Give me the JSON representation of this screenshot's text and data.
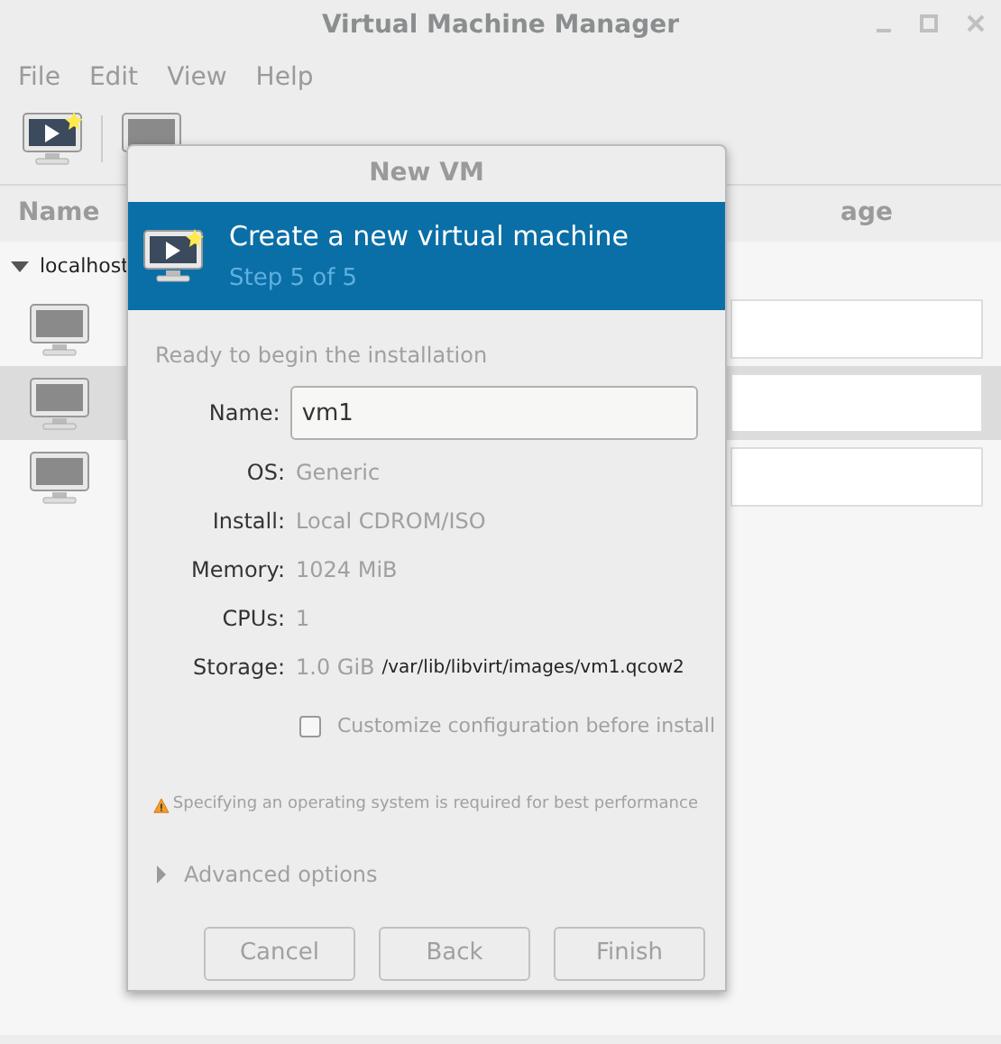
{
  "window": {
    "title": "Virtual Machine Manager"
  },
  "menu": [
    "File",
    "Edit",
    "View",
    "Help"
  ],
  "columns": [
    "Name",
    "age"
  ],
  "tree": {
    "label": "localhost",
    "expanded": true,
    "vms": [
      {
        "selected": false
      },
      {
        "selected": true
      },
      {
        "selected": false
      }
    ]
  },
  "dialog": {
    "title": "New VM",
    "header_title": "Create a new virtual machine",
    "step": "Step 5 of 5",
    "heading": "Ready to begin the installation",
    "name": {
      "label": "Name:",
      "value": "vm1"
    },
    "details": [
      {
        "label": "OS:",
        "value": "Generic"
      },
      {
        "label": "Install:",
        "value": "Local CDROM/ISO"
      },
      {
        "label": "Memory:",
        "value": "1024 MiB"
      },
      {
        "label": "CPUs:",
        "value": "1"
      },
      {
        "label": "Storage:",
        "value": "1.0 GiB",
        "path": "/var/lib/libvirt/images/vm1.qcow2"
      }
    ],
    "customize": {
      "label": "Customize configuration before install",
      "checked": false
    },
    "warning": "Specifying an operating system is required for best performance",
    "advanced": {
      "label": "Advanced options",
      "expanded": false
    },
    "buttons": [
      "Cancel",
      "Back",
      "Finish"
    ]
  }
}
